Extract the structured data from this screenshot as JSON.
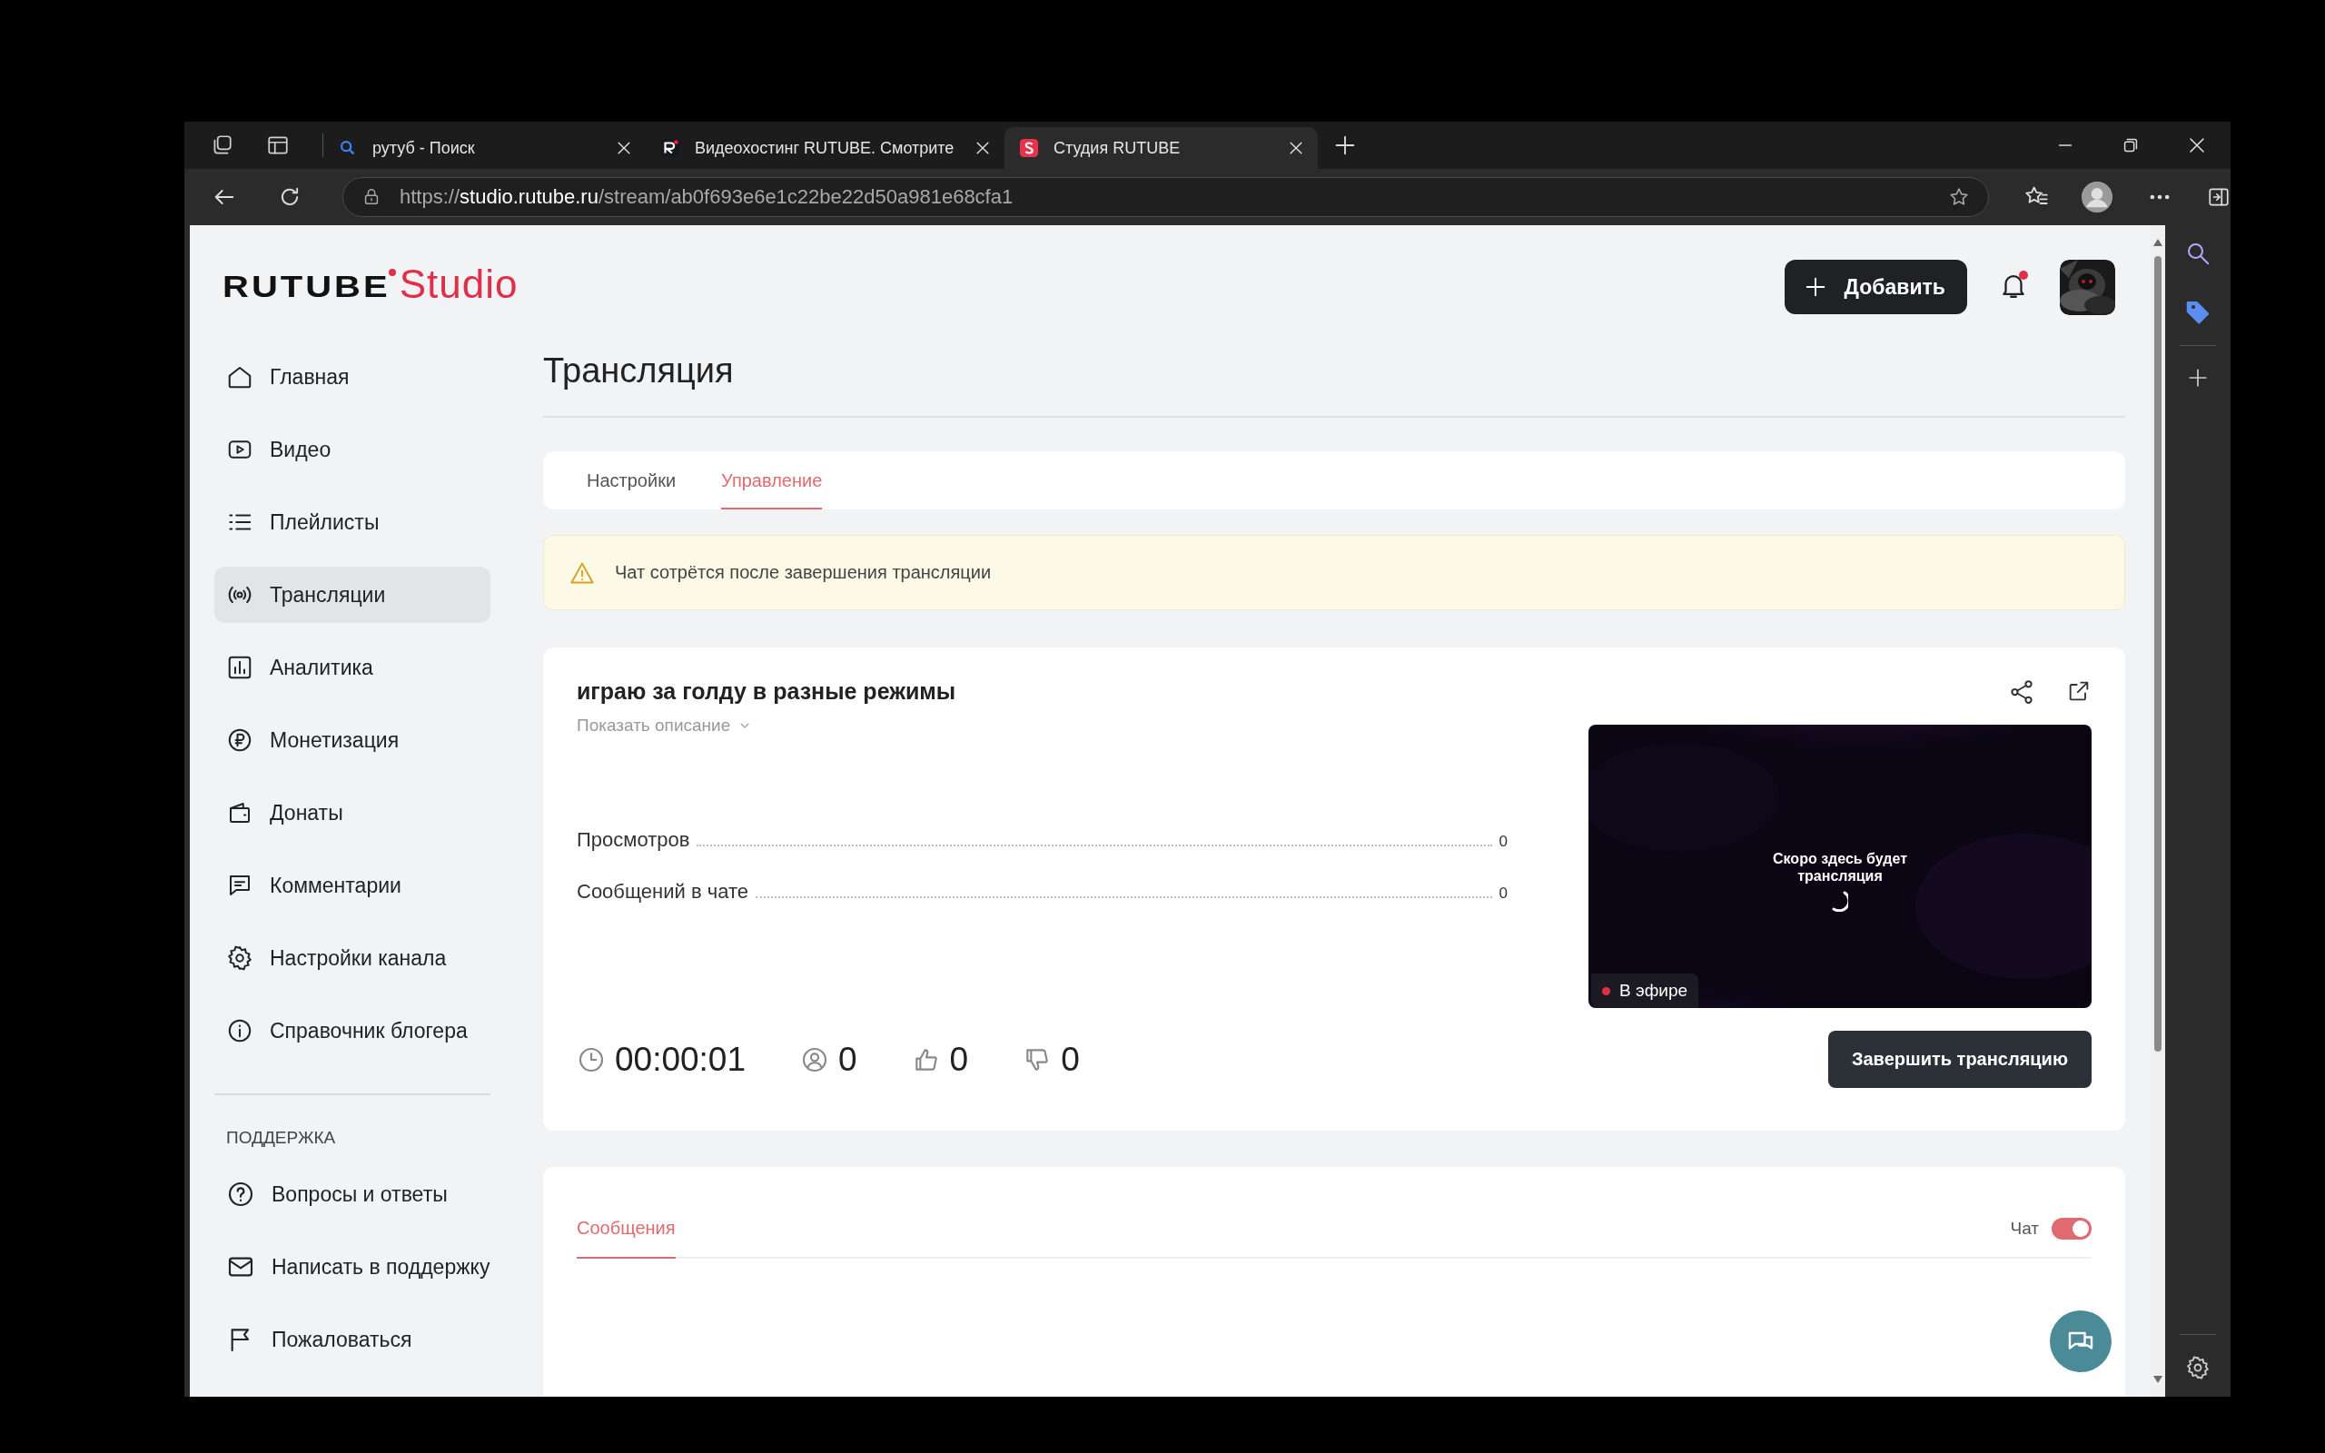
{
  "browser": {
    "tabs": [
      {
        "kind": "search",
        "title": "рутуб - Поиск",
        "selected": false
      },
      {
        "kind": "rutube",
        "title": "Видеохостинг RUTUBE. Смотрите",
        "selected": false
      },
      {
        "kind": "studio",
        "title": "Студия RUTUBE",
        "selected": true
      }
    ],
    "url": {
      "scheme": "https://",
      "host": "studio.rutube.ru",
      "path": "/stream/ab0f693e6e1c22be22d50a981e68cfa1"
    }
  },
  "logo": {
    "brand": "RUTUBE",
    "product": "Studio"
  },
  "header": {
    "add_button": "Добавить",
    "notifications_unread": true
  },
  "sidebar": {
    "items": [
      {
        "kind": "home",
        "label": "Главная",
        "selected": false
      },
      {
        "kind": "video",
        "label": "Видео",
        "selected": false
      },
      {
        "kind": "list",
        "label": "Плейлисты",
        "selected": false
      },
      {
        "kind": "broadcast",
        "label": "Трансляции",
        "selected": true
      },
      {
        "kind": "chart",
        "label": "Аналитика",
        "selected": false
      },
      {
        "kind": "ruble",
        "label": "Монетизация",
        "selected": false
      },
      {
        "kind": "wallet",
        "label": "Донаты",
        "selected": false
      },
      {
        "kind": "comment",
        "label": "Комментарии",
        "selected": false
      },
      {
        "kind": "gear",
        "label": "Настройки канала",
        "selected": false
      },
      {
        "kind": "info",
        "label": "Справочник блогера",
        "selected": false
      }
    ],
    "support_heading": "ПОДДЕРЖКА",
    "support_items": [
      {
        "kind": "question",
        "label": "Вопросы и ответы"
      },
      {
        "kind": "mail",
        "label": "Написать в поддержку"
      },
      {
        "kind": "flag",
        "label": "Пожаловаться"
      }
    ]
  },
  "page_title": "Трансляция",
  "tabs": [
    {
      "label": "Настройки",
      "selected": false
    },
    {
      "label": "Управление",
      "selected": true
    }
  ],
  "notice": "Чат сотрётся после завершения трансляции",
  "stream": {
    "title": "играю за голду в разные режимы",
    "show_description": "Показать описание",
    "stats": [
      {
        "label": "Просмотров",
        "value": "0"
      },
      {
        "label": "Сообщений в чате",
        "value": "0"
      }
    ],
    "preview": {
      "kind": "picture",
      "overlay": "Скоро здесь будет трансляция",
      "live_badge": "В эфире"
    },
    "counters": [
      {
        "kind": "time",
        "value": "00:00:01"
      },
      {
        "kind": "viewers",
        "value": "0"
      },
      {
        "kind": "likes",
        "value": "0"
      },
      {
        "kind": "dislikes",
        "value": "0"
      }
    ],
    "end_button": "Завершить трансляцию"
  },
  "chat": {
    "tabs": [
      {
        "label": "Сообщения",
        "selected": true
      }
    ],
    "toggle_label": "Чат",
    "toggle_on": true
  }
}
